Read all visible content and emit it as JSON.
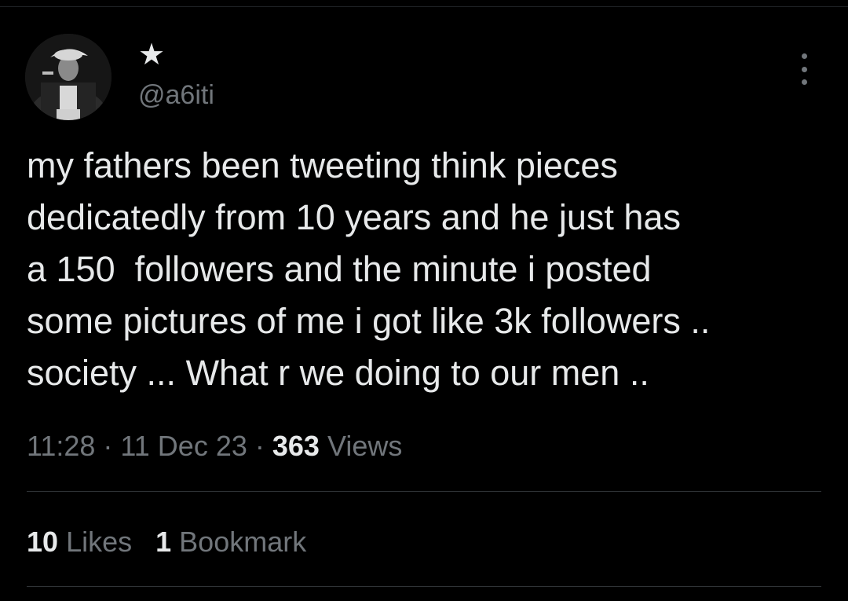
{
  "author": {
    "display_name": "★",
    "handle": "@a6iti"
  },
  "tweet": {
    "lines": [
      "my fathers been tweeting think pieces",
      "dedicatedly from 10 years and he just has",
      "a 150  followers and the minute i posted",
      "some pictures of me i got like 3k followers ..",
      "society ... What r we doing to our men .."
    ]
  },
  "meta": {
    "time": "11:28",
    "separator": " · ",
    "date": "11 Dec 23",
    "views_count": "363",
    "views_label": "Views"
  },
  "stats": {
    "likes_count": "10",
    "likes_label": "Likes",
    "bookmarks_count": "1",
    "bookmarks_label": "Bookmark"
  },
  "colors": {
    "background": "#000000",
    "primary_text": "#e7e9ea",
    "secondary_text": "#71767b",
    "divider": "#2f3336"
  },
  "icons": {
    "more": "more-horizontal-dots-icon"
  }
}
